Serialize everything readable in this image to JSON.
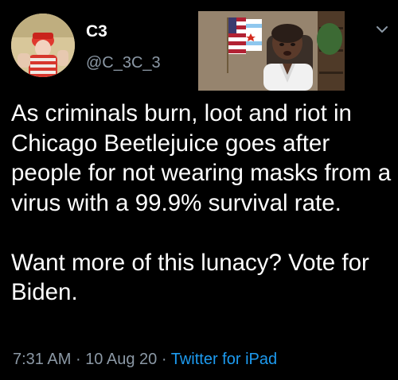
{
  "tweet": {
    "display_name": "C3",
    "handle": "@C_3C_3",
    "text_paragraph_1": "As criminals burn, loot and riot in Chicago Beetlejuice goes after people for not wearing masks from a virus with a 99.9% survival rate.",
    "text_paragraph_2": "Want more of this lunacy? Vote for Biden.",
    "time": "7:31 AM",
    "separator_1": "·",
    "date": "10 Aug 20",
    "separator_2": "·",
    "source": "Twitter for iPad"
  },
  "icons": {
    "menu": "chevron-down-icon"
  },
  "colors": {
    "background": "#000000",
    "primary_text": "#ffffff",
    "secondary_text": "#8b98a5",
    "link": "#1d9bf0"
  }
}
